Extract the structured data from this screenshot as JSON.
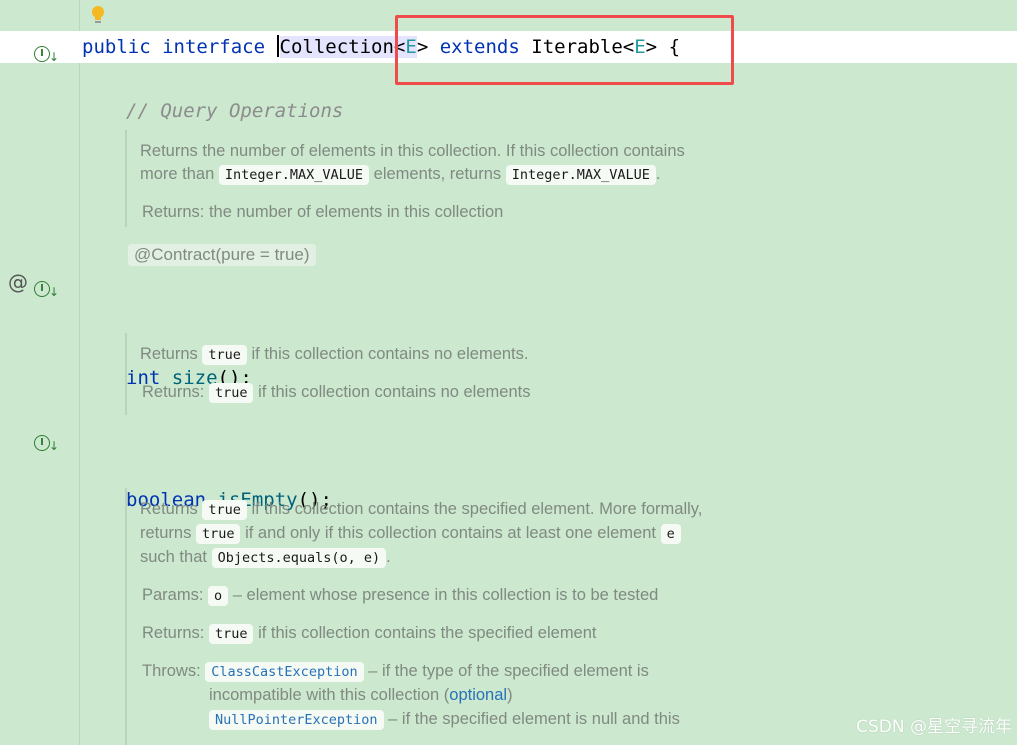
{
  "editor": {
    "line_declaration": {
      "kw_public": "public",
      "kw_interface": "interface",
      "class_name_first": "C",
      "class_name_rest": "ollection",
      "generic_open": "<",
      "generic_type": "E",
      "generic_close": ">",
      "kw_extends": "extends",
      "parent_type": "Iterable",
      "parent_generic_open": "<",
      "parent_generic_type": "E",
      "parent_generic_close": ">",
      "brace": "{"
    },
    "comment_query": "// Query Operations",
    "doc_size": {
      "text_1": "Returns the number of elements in this collection. If this collection contains",
      "text_2_a": "more than",
      "code_1": "Integer.MAX_VALUE",
      "text_2_b": "elements, returns",
      "code_2": "Integer.MAX_VALUE",
      "text_2_c": ".",
      "returns_label": "Returns:",
      "returns_text": "the number of elements in this collection"
    },
    "annotation_contract": "@Contract(pure = true)",
    "line_size": {
      "type": "int",
      "name": "size",
      "rest": "();"
    },
    "doc_isempty": {
      "text_a": "Returns",
      "code": "true",
      "text_b": "if this collection contains no elements.",
      "returns_label": "Returns:",
      "returns_code": "true",
      "returns_text": "if this collection contains no elements"
    },
    "line_isempty": {
      "type": "boolean",
      "name": "isEmpty",
      "rest": "();"
    },
    "doc_contains": {
      "l1_a": "Returns",
      "l1_code": "true",
      "l1_b": "if this collection contains the specified element. More formally,",
      "l2_a": "returns",
      "l2_code": "true",
      "l2_b": "if and only if this collection contains at least one element",
      "l2_code2": "e",
      "l3_a": "such that",
      "l3_code": "Objects.equals(o, e)",
      "l3_b": ".",
      "params_label": "Params:",
      "params_code": "o",
      "params_text": "– element whose presence in this collection is to be tested",
      "returns_label": "Returns:",
      "returns_code": "true",
      "returns_text": "if this collection contains the specified element",
      "throws_label": "Throws:",
      "throws_1_code": "ClassCastException",
      "throws_1_text": "– if the type of the specified element is",
      "throws_1_text2": "incompatible with this collection (",
      "throws_1_link": "optional",
      "throws_1_close": ")",
      "throws_2_code": "NullPointerException",
      "throws_2_text": "– if the specified element is null and this"
    }
  },
  "gutter_icons": {
    "impl_icon_letter": "I",
    "impl_icon_arrow": "↓",
    "at_icon": "@"
  },
  "watermark": "CSDN @星空寻流年",
  "colors": {
    "background": "#cce8cf",
    "keyword": "#0033b3",
    "function": "#00627a",
    "type_param": "#20999d",
    "highlight_box": "#ef4b4b"
  }
}
